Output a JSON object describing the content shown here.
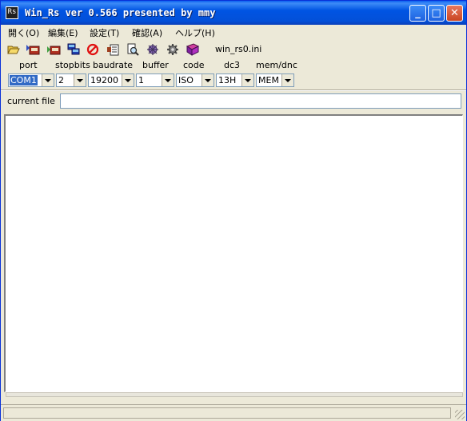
{
  "window": {
    "title": "Win_Rs ver 0.566  presented by mmy",
    "app_icon_glyph": "Rs",
    "minimize_glyph": "_",
    "maximize_glyph": "□",
    "close_glyph": "✕",
    "colors": {
      "titlebar": "#0054E3",
      "frame": "#ECE9D8",
      "close": "#C94522"
    }
  },
  "menu": [
    "開く(O)",
    "編集(E)",
    "設定(T)",
    "確認(A)",
    "ヘルプ(H)"
  ],
  "toolbar": {
    "icons": [
      "open-folder-icon",
      "receive-icon",
      "send-icon",
      "transfer-icon",
      "stop-icon",
      "list-icon",
      "find-icon",
      "gear-icon",
      "settings-icon",
      "book-icon"
    ],
    "ini_file": "win_rs0.ini"
  },
  "settings": {
    "labels": {
      "port": "port",
      "stopbits": "stopbits",
      "baudrate": "baudrate",
      "buffer": "buffer",
      "code": "code",
      "dc3": "dc3",
      "mem_dnc": "mem/dnc"
    },
    "values": {
      "port": "COM1",
      "stopbits": "2",
      "baudrate": "19200",
      "buffer": "1",
      "code": "ISO",
      "dc3": "13H",
      "mem_dnc": "MEM"
    }
  },
  "current_file": {
    "label": "current file",
    "value": ""
  }
}
